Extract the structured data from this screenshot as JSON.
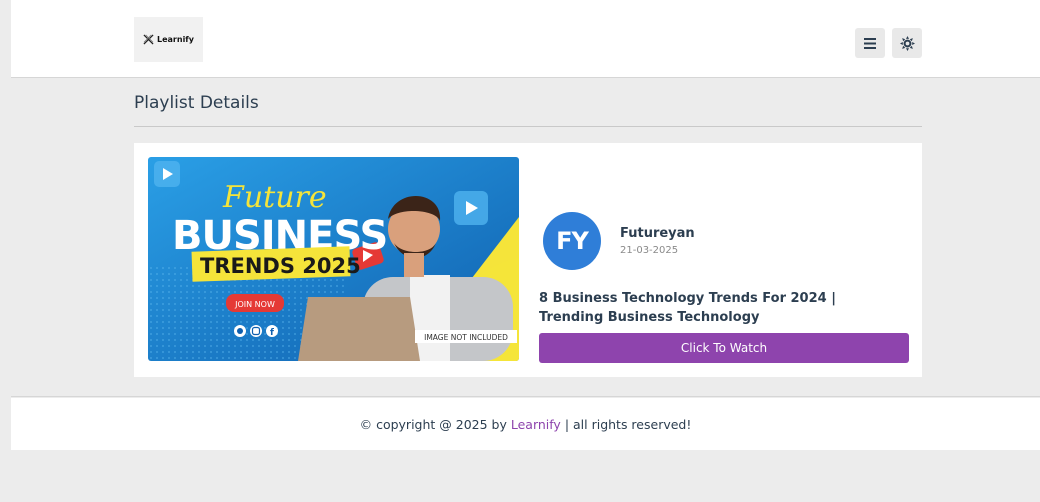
{
  "header": {
    "logo_text": "Learnify",
    "menu_icon": "menu-icon",
    "theme_icon": "sun-icon"
  },
  "main": {
    "title": "Playlist Details"
  },
  "video": {
    "thumbnail": {
      "script_word": "Future",
      "headline": "BUSINESS",
      "subheadline": "TRENDS 2025",
      "cta": "JOIN NOW",
      "disclaimer": "IMAGE NOT INCLUDED",
      "social_icons": [
        "twitter-icon",
        "instagram-icon",
        "facebook-icon"
      ]
    },
    "channel": {
      "avatar_initials": "FY",
      "name": "Futureyan",
      "date": "21-03-2025"
    },
    "title": "8 Business Technology Trends For 2024 | Trending Business Technology",
    "watch_label": "Click To Watch"
  },
  "footer": {
    "prefix": "© copyright @ 2025 by ",
    "brand": "Learnify",
    "suffix": " | all rights reserved!"
  },
  "colors": {
    "accent": "#8e44ad",
    "avatar_bg": "#2f7ed8",
    "page_bg": "#ececec",
    "thumbnail_blue": "#1f87d6",
    "thumbnail_yellow": "#f5e43a"
  }
}
